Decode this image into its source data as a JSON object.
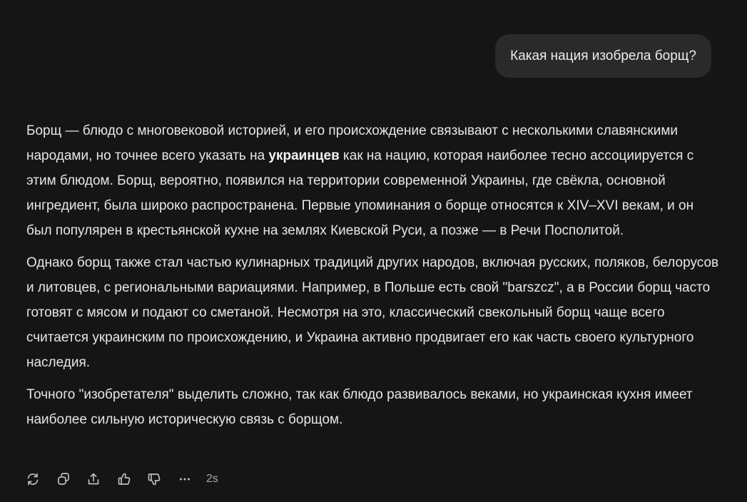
{
  "user_message": "Какая нация изобрела борщ?",
  "answer": {
    "p1_a": "Борщ — блюдо с многовековой историей, и его происхождение связывают с несколькими славянскими народами, но точнее всего указать на ",
    "p1_bold": "украинцев",
    "p1_b": " как на нацию, которая наиболее тесно ассоциируется с этим блюдом. Борщ, вероятно, появился на территории современной Украины, где свёкла, основной ингредиент, была широко распространена. Первые упоминания о борще относятся к XIV–XVI векам, и он был популярен в крестьянской кухне на землях Киевской Руси, а позже — в Речи Посполитой.",
    "p2": "Однако борщ также стал частью кулинарных традиций других народов, включая русских, поляков, белорусов и литовцев, с региональными вариациями. Например, в Польше есть свой \"barszcz\", а в России борщ часто готовят с мясом и подают со сметаной. Несмотря на это, классический свекольный борщ чаще всего считается украинским по происхождению, и Украина активно продвигает его как часть своего культурного наследия.",
    "p3": "Точного \"изобретателя\" выделить сложно, так как блюдо развивалось веками, но украинская кухня имеет наиболее сильную историческую связь с борщом."
  },
  "toolbar": {
    "icons": [
      "regenerate-icon",
      "copy-icon",
      "share-icon",
      "thumbs-up-icon",
      "thumbs-down-icon",
      "more-icon"
    ],
    "response_time": "2s"
  },
  "colors": {
    "background": "#151515",
    "bubble": "#2a2a2a",
    "text": "#e6e6e6",
    "icon": "#bdbdbd"
  }
}
